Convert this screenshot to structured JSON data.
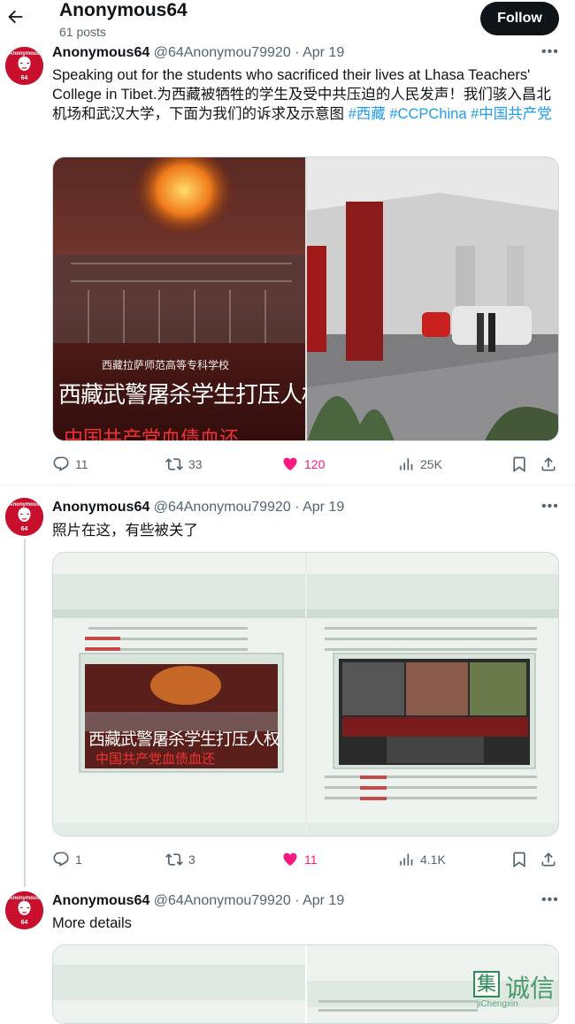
{
  "header": {
    "name": "Anonymous64",
    "posts": "61 posts",
    "follow_label": "Follow"
  },
  "avatar_text": "Anonymous 64",
  "tweets": [
    {
      "name": "Anonymous64",
      "handle": "@64Anonymou79920",
      "date": "Apr 19",
      "text_plain": "Speaking out for the students who sacrificed their lives at Lhasa Teachers' College in Tibet.为西藏被牺牲的学生及受中共压迫的人民发声！我们骇入昌北机场和武汉大学，下面为我们的诉求及示意图 ",
      "hashtags": [
        "#西藏",
        "#CCPChina",
        "#中国共产党"
      ],
      "media": {
        "left_caption_small": "西藏拉萨师范高等专科学校",
        "left_caption_big": "西藏武警屠杀学生打压人权",
        "left_caption_bottom": "中国共产党血债血还"
      },
      "replies": "11",
      "retweets": "33",
      "likes": "120",
      "views": "25K"
    },
    {
      "name": "Anonymous64",
      "handle": "@64Anonymou79920",
      "date": "Apr 19",
      "text_plain": "照片在这，有些被关了",
      "media": {
        "left_caption_big": "西藏武警屠杀学生打压人权",
        "left_caption_bottom": "中国共产党血债血还"
      },
      "replies": "1",
      "retweets": "3",
      "likes": "11",
      "views": "4.1K"
    },
    {
      "name": "Anonymous64",
      "handle": "@64Anonymou79920",
      "date": "Apr 19",
      "text_plain": "More details"
    }
  ],
  "watermark": {
    "glyph": "集",
    "text": "诚信",
    "sub": "jiChengxin"
  },
  "colors": {
    "accent": "#1d9bf0",
    "like": "#f91880",
    "avatar": "#c8102e"
  }
}
